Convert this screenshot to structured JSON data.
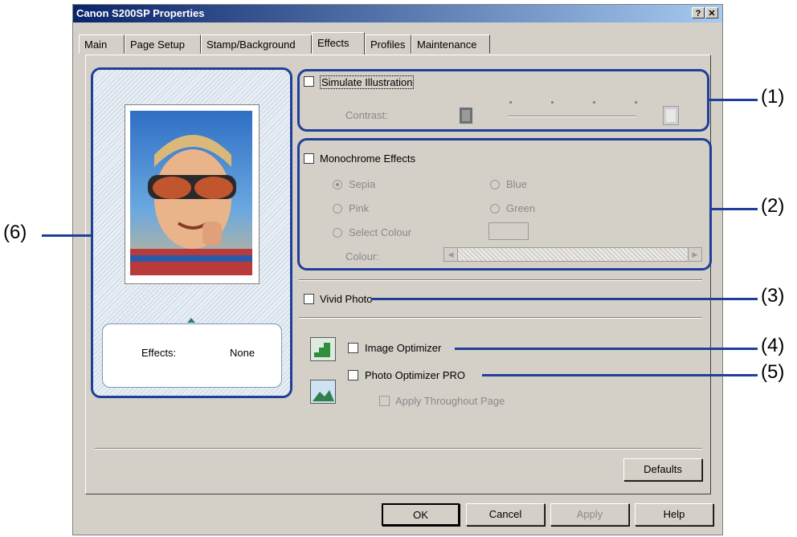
{
  "window": {
    "title": "Canon S200SP Properties",
    "help_btn": "?",
    "close_btn": "✕"
  },
  "tabs": [
    {
      "label": "Main"
    },
    {
      "label": "Page Setup"
    },
    {
      "label": "Stamp/Background"
    },
    {
      "label": "Effects"
    },
    {
      "label": "Profiles"
    },
    {
      "label": "Maintenance"
    }
  ],
  "preview": {
    "effects_label": "Effects:",
    "effects_value": "None"
  },
  "simulate": {
    "label": "Simulate Illustration",
    "contrast_label": "Contrast:"
  },
  "monochrome": {
    "label": "Monochrome Effects",
    "sepia": "Sepia",
    "blue": "Blue",
    "pink": "Pink",
    "green": "Green",
    "select_colour": "Select Colour",
    "colour_label": "Colour:"
  },
  "vivid": {
    "label": "Vivid Photo"
  },
  "optimizer": {
    "label": "Image Optimizer"
  },
  "photo_optimizer": {
    "label": "Photo Optimizer PRO",
    "apply_throughout": "Apply Throughout Page"
  },
  "buttons": {
    "defaults": "Defaults",
    "ok": "OK",
    "cancel": "Cancel",
    "apply": "Apply",
    "help": "Help"
  },
  "callouts": {
    "c1": "(1)",
    "c2": "(2)",
    "c3": "(3)",
    "c4": "(4)",
    "c5": "(5)",
    "c6": "(6)"
  },
  "colors": {
    "callout": "#1f3f9a",
    "title_start": "#0a246a",
    "face": "#d4d0c8"
  }
}
